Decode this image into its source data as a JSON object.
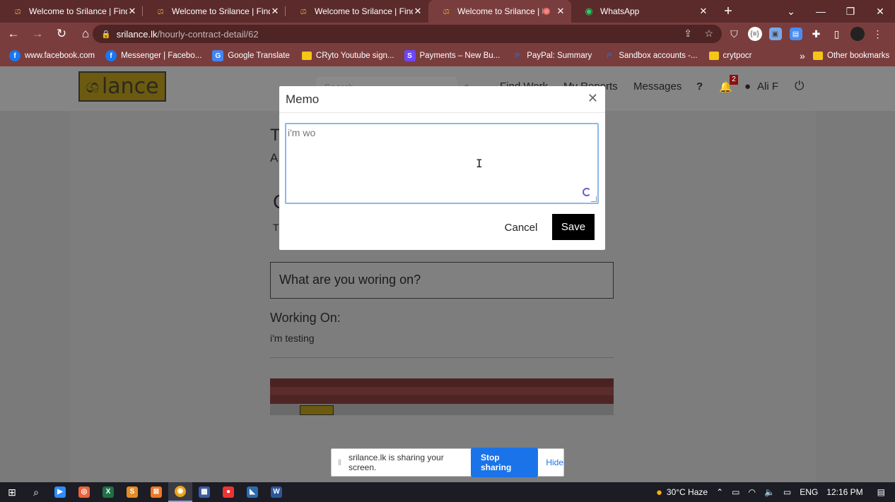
{
  "browser": {
    "tabs": [
      {
        "title": "Welcome to Srilance | Find D",
        "icon": "srilance-icon",
        "active": false
      },
      {
        "title": "Welcome to Srilance | Find D",
        "icon": "srilance-icon",
        "active": false
      },
      {
        "title": "Welcome to Srilance | Find D",
        "icon": "srilance-icon",
        "active": false
      },
      {
        "title": "Welcome to Srilance | Fi",
        "icon": "srilance-icon",
        "active": true,
        "recording": true
      },
      {
        "title": "WhatsApp",
        "icon": "whatsapp-icon",
        "active": false
      }
    ],
    "url_host": "srilance.lk",
    "url_path": "/hourly-contract-detail/62",
    "bookmarks": [
      {
        "label": "www.facebook.com",
        "icon": "facebook-icon"
      },
      {
        "label": "Messenger | Facebo...",
        "icon": "facebook-icon"
      },
      {
        "label": "Google Translate",
        "icon": "google-translate-icon"
      },
      {
        "label": "CRyto Youtube sign...",
        "icon": "folder-icon"
      },
      {
        "label": "Payments – New Bu...",
        "icon": "s-icon"
      },
      {
        "label": "PayPal: Summary",
        "icon": "paypal-icon"
      },
      {
        "label": "Sandbox accounts -...",
        "icon": "paypal-icon"
      },
      {
        "label": "crytpocr",
        "icon": "folder-icon"
      }
    ],
    "bookmarks_overflow": "»",
    "other_bookmarks": "Other bookmarks"
  },
  "site": {
    "logo_text": "lance",
    "search_placeholder": "Search",
    "nav": {
      "find_work": "Find Work",
      "my_reports": "My Reports",
      "messages": "Messages",
      "user": "Ali F"
    },
    "notifications_count": "2",
    "what_working_placeholder": "What are you woring on?",
    "working_on_label": "Working On:",
    "working_on_value": "i'm testing",
    "partial_letters": {
      "a": "T",
      "b": "A",
      "c": "C",
      "d": "T"
    }
  },
  "modal": {
    "title": "Memo",
    "textarea_value": "i'm wo",
    "cancel_label": "Cancel",
    "save_label": "Save"
  },
  "share_bar": {
    "message": "srilance.lk is sharing your screen.",
    "stop_label": "Stop sharing",
    "hide_label": "Hide"
  },
  "taskbar": {
    "weather": "30°C  Haze",
    "language": "ENG",
    "time": "12:16 PM"
  }
}
